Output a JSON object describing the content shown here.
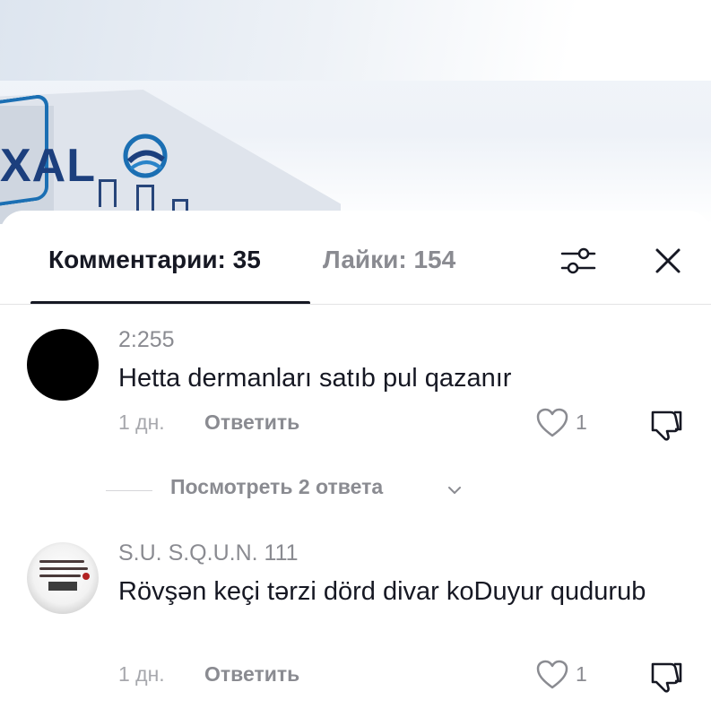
{
  "video": {
    "logo_text": "XAL"
  },
  "tabs": {
    "comments_label": "Комментарии: 35",
    "likes_label": "Лайки: 154"
  },
  "icons": {
    "filter": "sliders-icon",
    "close": "close-icon",
    "like": "heart-outline-icon",
    "dislike": "thumbs-down-icon",
    "expand": "chevron-down-icon"
  },
  "colors": {
    "primary_text": "#161823",
    "secondary_text": "#8a8b91",
    "muted_text": "#a7a8ad",
    "logo_blue": "#1c3f7d"
  },
  "comments": [
    {
      "username": "2:255",
      "text": "Hetta dermanları satıb pul qazanır",
      "time": "1 дн.",
      "reply_label": "Ответить",
      "likes": "1"
    },
    {
      "username": "S.U. S.Q.U.N. 111",
      "text": "Rövşən keçi tərzi dörd divar koDuyur qudurub",
      "time": "1 дн.",
      "reply_label": "Ответить",
      "likes": "1"
    }
  ],
  "view_replies": {
    "label": "Посмотреть 2 ответа"
  }
}
